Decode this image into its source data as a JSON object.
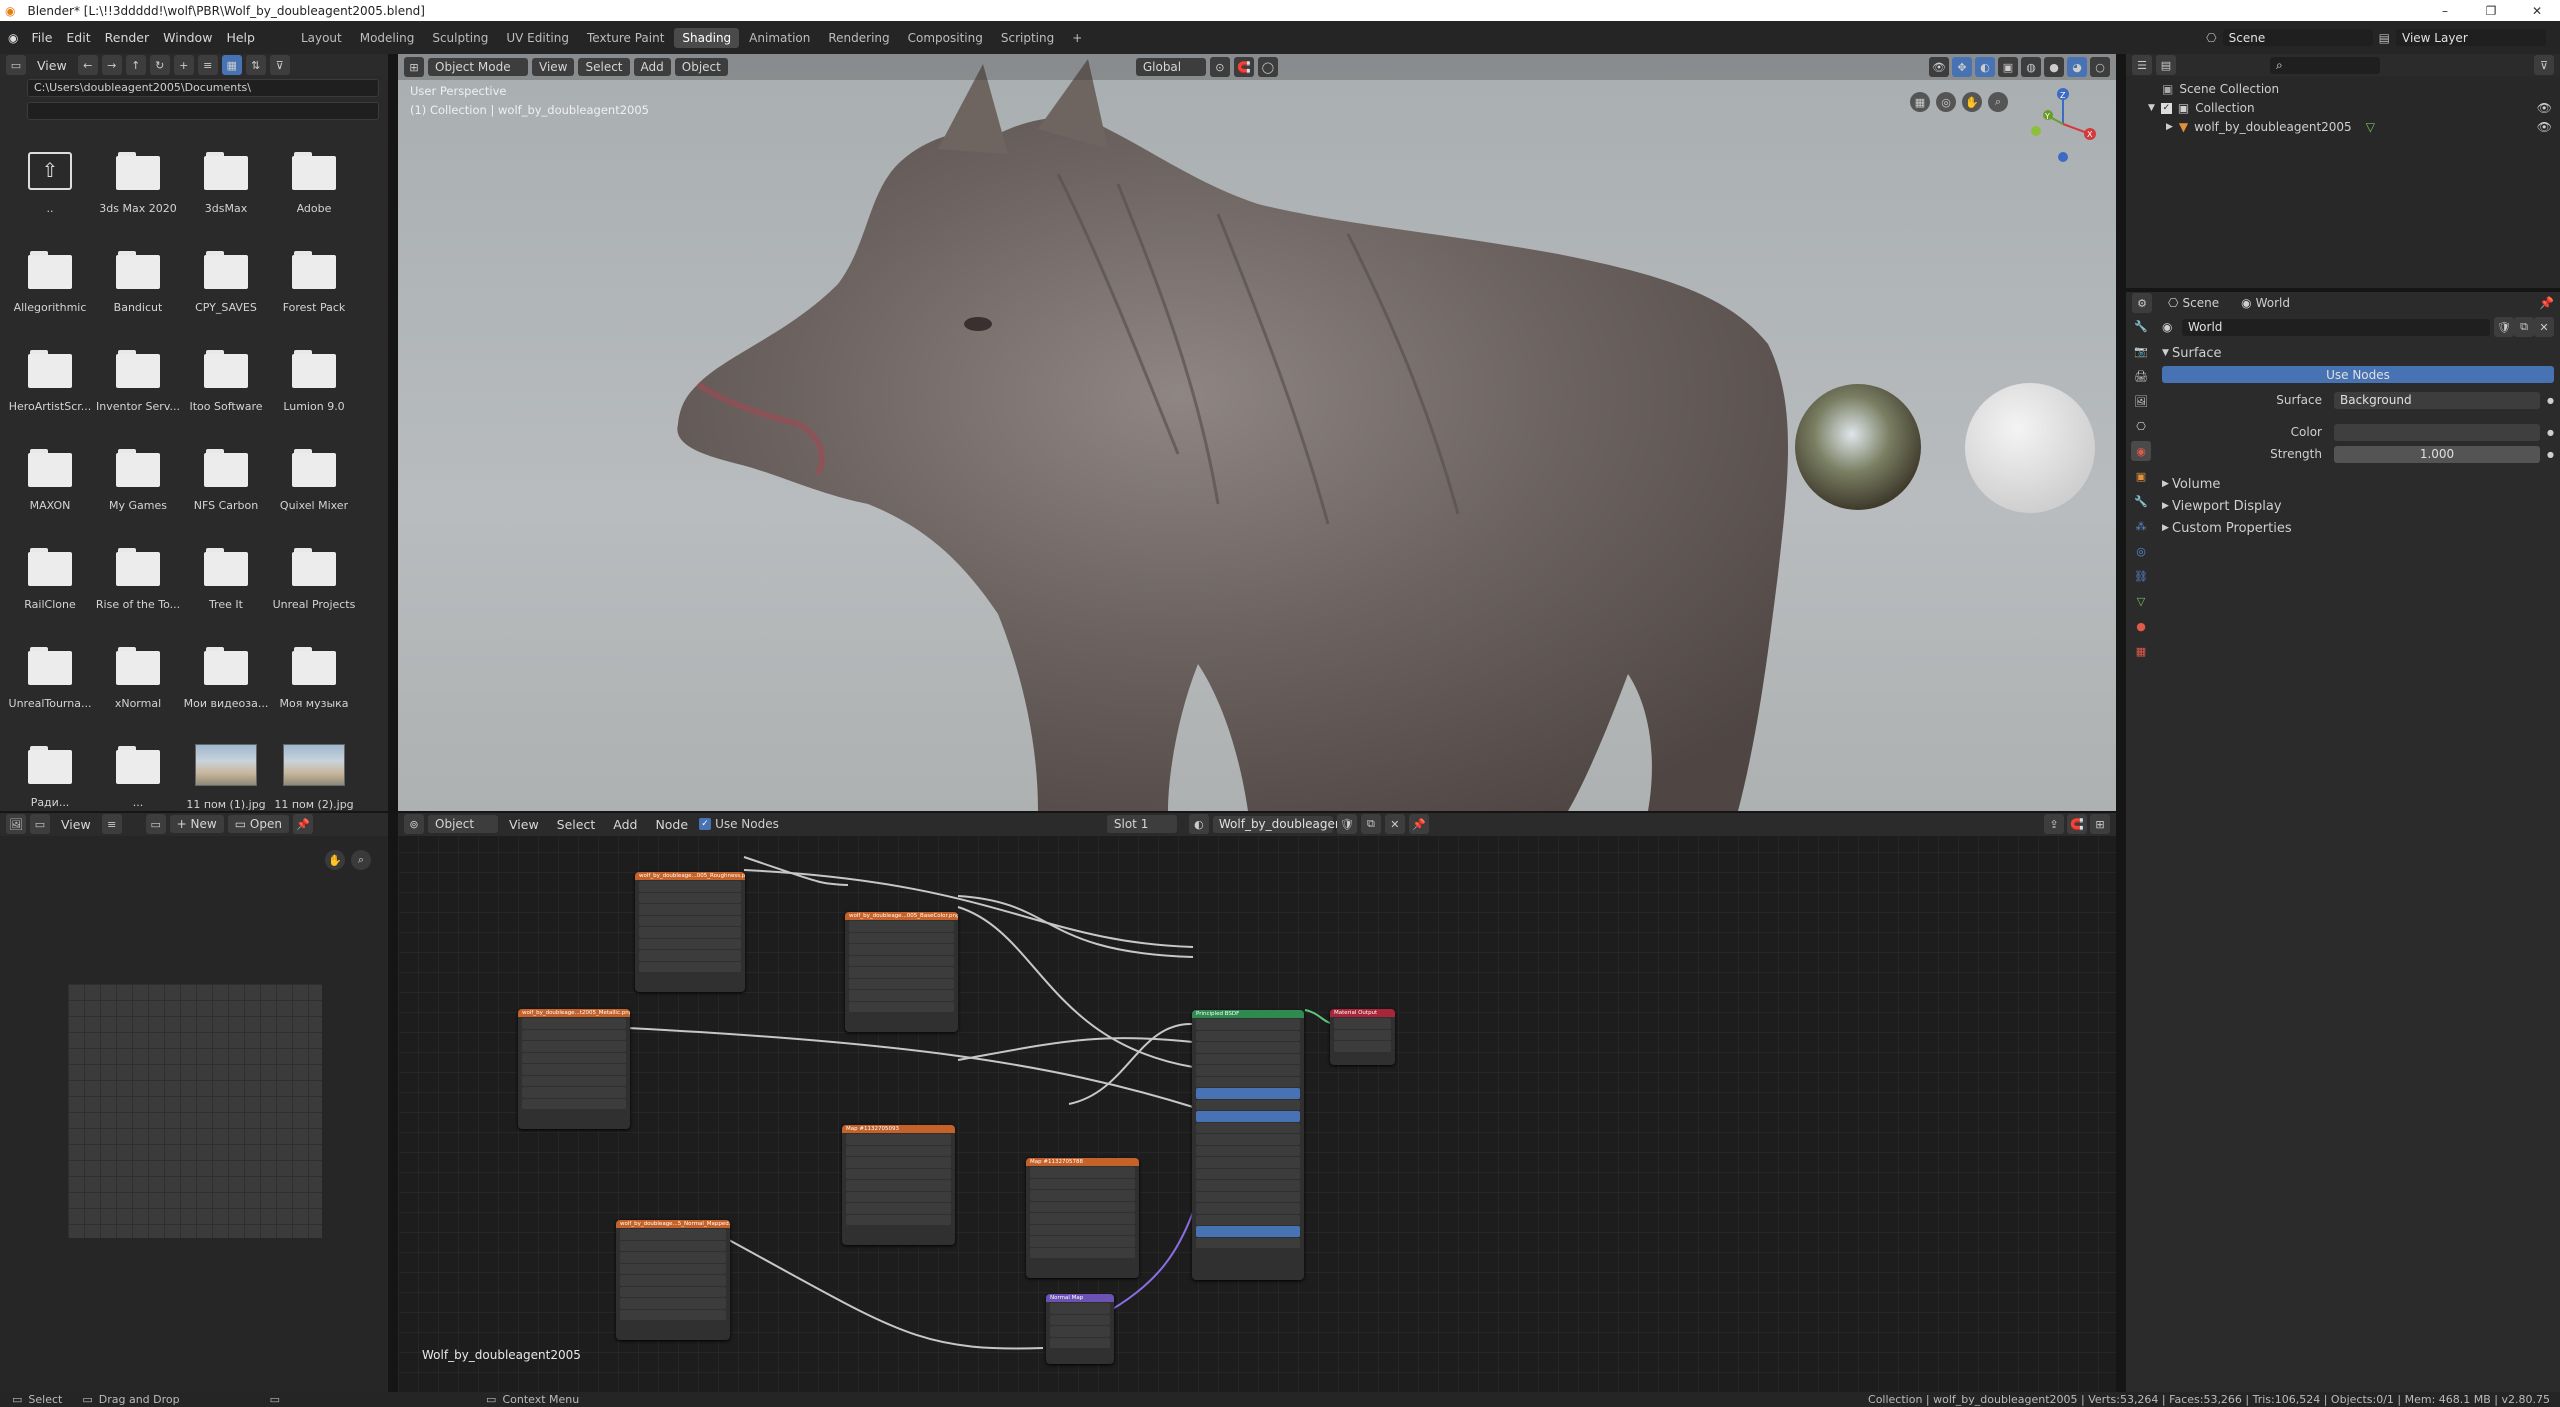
{
  "window": {
    "title": "Blender* [L:\\!!3ddddd!\\wolf\\PBR\\Wolf_by_doubleagent2005.blend]",
    "controls": [
      "–",
      "❐",
      "✕"
    ]
  },
  "menus": [
    "File",
    "Edit",
    "Render",
    "Window",
    "Help"
  ],
  "workspaces": [
    "Layout",
    "Modeling",
    "Sculpting",
    "UV Editing",
    "Texture Paint",
    "Shading",
    "Animation",
    "Rendering",
    "Compositing",
    "Scripting",
    "+"
  ],
  "active_workspace": "Shading",
  "scene_selector": {
    "value": "Scene"
  },
  "view_layer": {
    "value": "View Layer"
  },
  "file_browser": {
    "view_label": "View",
    "path": "C:\\Users\\doubleagent2005\\Documents\\",
    "items": [
      {
        "name": "..",
        "kind": "parent"
      },
      {
        "name": "3ds Max 2020",
        "kind": "folder"
      },
      {
        "name": "3dsMax",
        "kind": "folder"
      },
      {
        "name": "Adobe",
        "kind": "folder"
      },
      {
        "name": "Allegorithmic",
        "kind": "folder"
      },
      {
        "name": "Bandicut",
        "kind": "folder"
      },
      {
        "name": "CPY_SAVES",
        "kind": "folder"
      },
      {
        "name": "Forest Pack",
        "kind": "folder"
      },
      {
        "name": "HeroArtistScr...",
        "kind": "folder"
      },
      {
        "name": "Inventor Serv...",
        "kind": "folder"
      },
      {
        "name": "Itoo Software",
        "kind": "folder"
      },
      {
        "name": "Lumion 9.0",
        "kind": "folder"
      },
      {
        "name": "MAXON",
        "kind": "folder"
      },
      {
        "name": "My Games",
        "kind": "folder"
      },
      {
        "name": "NFS Carbon",
        "kind": "folder"
      },
      {
        "name": "Quixel Mixer",
        "kind": "folder"
      },
      {
        "name": "RailClone",
        "kind": "folder"
      },
      {
        "name": "Rise of the To...",
        "kind": "folder"
      },
      {
        "name": "Tree It",
        "kind": "folder"
      },
      {
        "name": "Unreal Projects",
        "kind": "folder"
      },
      {
        "name": "UnrealTourna...",
        "kind": "folder"
      },
      {
        "name": "xNormal",
        "kind": "folder"
      },
      {
        "name": "Мои видеоза...",
        "kind": "folder"
      },
      {
        "name": "Моя музыка",
        "kind": "folder"
      },
      {
        "name": "Ради...",
        "kind": "folder"
      },
      {
        "name": "...",
        "kind": "folder"
      },
      {
        "name": "11 пом (1).jpg",
        "kind": "image"
      },
      {
        "name": "11 пом (2).jpg",
        "kind": "image"
      }
    ]
  },
  "viewport": {
    "mode": "Object Mode",
    "menus": [
      "View",
      "Select",
      "Add",
      "Object"
    ],
    "orientation": "Global",
    "overlay_title": "User Perspective",
    "overlay_subtitle": "(1) Collection | wolf_by_doubleagent2005",
    "gizmo_axes": [
      "Z",
      "Y",
      "X"
    ]
  },
  "outliner": {
    "search_placeholder": "",
    "root": "Scene Collection",
    "collection": "Collection",
    "object": "wolf_by_doubleagent2005"
  },
  "properties": {
    "breadcrumb_scene": "Scene",
    "breadcrumb_world": "World",
    "world_name": "World",
    "panel_surface": "Surface",
    "use_nodes_button": "Use Nodes",
    "surface_label": "Surface",
    "surface_value": "Background",
    "color_label": "Color",
    "strength_label": "Strength",
    "strength_value": "1.000",
    "collapsed_panels": [
      "Volume",
      "Viewport Display",
      "Custom Properties"
    ]
  },
  "image_editor": {
    "view_label": "View",
    "new_label": "New",
    "open_label": "Open"
  },
  "node_editor": {
    "object_selector": "Object",
    "menus": [
      "View",
      "Select",
      "Add",
      "Node"
    ],
    "use_nodes_label": "Use Nodes",
    "slot": "Slot 1",
    "material": "Wolf_by_doubleagen...",
    "footer_material": "Wolf_by_doubleagent2005",
    "nodes": [
      {
        "id": "img-roughness",
        "title": "wolf_by_doubleage...005_Roughness.png",
        "color": "#c4622a"
      },
      {
        "id": "img-basecolor",
        "title": "wolf_by_doubleage...005_BaseColor.png",
        "color": "#c4622a"
      },
      {
        "id": "img-metallic",
        "title": "wolf_by_doubleage...t2005_Metallic.png",
        "color": "#c4622a"
      },
      {
        "id": "img-map1",
        "title": "Map #1132705093",
        "color": "#c4622a"
      },
      {
        "id": "img-map2",
        "title": "Map #1132705788",
        "color": "#c4622a"
      },
      {
        "id": "img-normal",
        "title": "wolf_by_doubleage...5_Normal_Mapped.png",
        "color": "#c4622a"
      },
      {
        "id": "normal-map",
        "title": "Normal Map",
        "color": "#6b52b3"
      },
      {
        "id": "principled",
        "title": "Principled BSDF",
        "color": "#2e8a4f"
      },
      {
        "id": "output",
        "title": "Material Output",
        "color": "#a8253a"
      }
    ]
  },
  "status_bar": {
    "left": [
      "Select",
      "Drag and Drop",
      "Context Menu"
    ],
    "right": "Collection | wolf_by_doubleagent2005 | Verts:53,264 | Faces:53,266 | Tris:106,524 | Objects:0/1 | Mem: 468.1 MB | v2.80.75"
  },
  "colors": {
    "accent": "#4772b3",
    "active_tab": "#4a4a4a",
    "panel": "#2b2b2b",
    "node_principled": "#2e8a4f",
    "node_image": "#c4622a",
    "node_output": "#a8253a",
    "node_vector": "#6b52b3"
  }
}
